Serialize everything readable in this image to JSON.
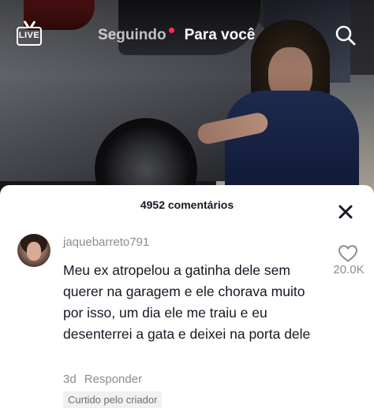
{
  "topbar": {
    "live_label": "LIVE",
    "tab_following": "Seguindo",
    "tab_foryou": "Para você",
    "notification_dot_color": "#fe2c55",
    "search_icon": "search-icon"
  },
  "comments": {
    "title": "4952 comentários",
    "close_icon": "close-icon",
    "items": [
      {
        "username": "jaquebarreto791",
        "text": "Meu ex atropelou a gatinha dele sem querer na garagem e ele chorava muito por isso, um dia ele me traiu e eu desenterrei a gata e deixei na porta dele",
        "likes": "20.0K",
        "time": "3d",
        "reply_label": "Responder",
        "badge": "Curtido pelo criador"
      }
    ]
  }
}
